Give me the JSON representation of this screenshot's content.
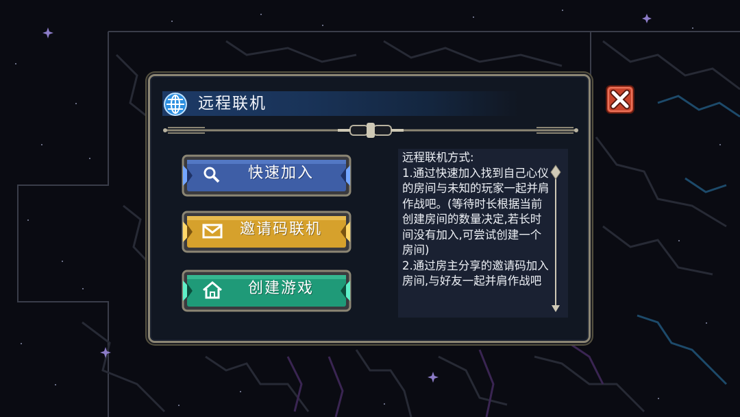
{
  "dialog": {
    "title": "远程联机"
  },
  "buttons": {
    "quick_join": "快速加入",
    "invite_code": "邀请码联机",
    "create_game": "创建游戏"
  },
  "info": {
    "text": "远程联机方式:\n1.通过快速加入找到自己心仪的房间与未知的玩家一起并肩作战吧。(等待时长根据当前创建房间的数量决定,若长时间没有加入,可尝试创建一个房间)\n2.通过房主分享的邀请码加入房间,与好友一起并肩作战吧"
  },
  "colors": {
    "quick_join": "#3e5ea6",
    "invite_code": "#d6a12c",
    "create_game": "#1f9a78",
    "title_bar": "#1d3a66",
    "panel_border": "#8c8674",
    "close_red": "#c8442c"
  },
  "icons": {
    "title": "globe-icon",
    "quick_join": "magnifier-icon",
    "invite_code": "envelope-icon",
    "create_game": "house-icon",
    "close": "close-x-icon"
  }
}
